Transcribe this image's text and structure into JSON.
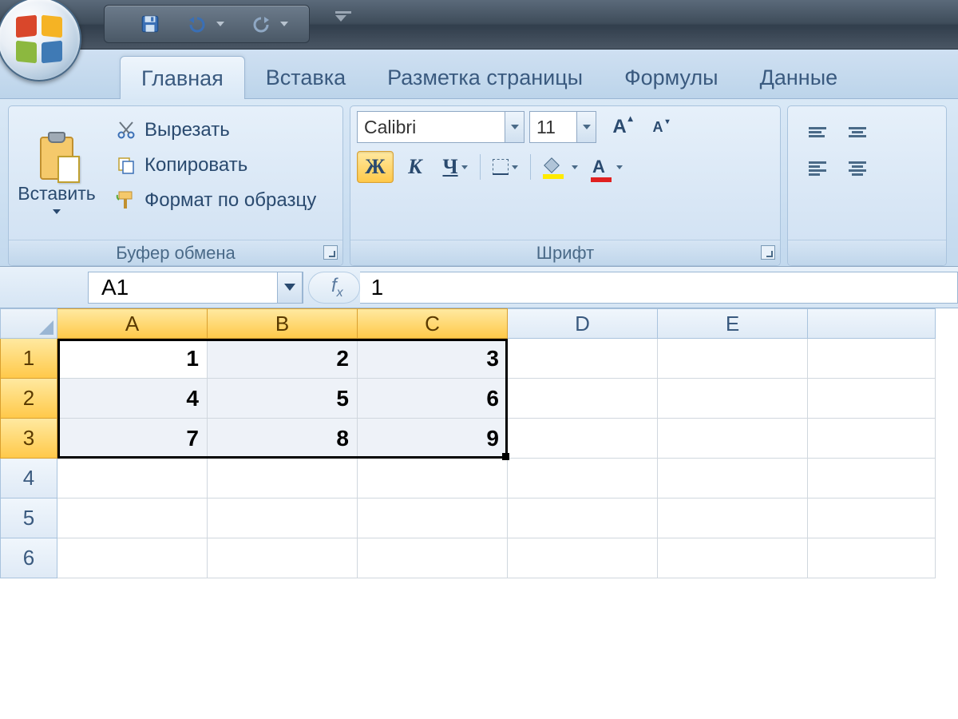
{
  "qat": {
    "save": "save",
    "undo": "undo",
    "redo": "redo",
    "customize": "customize"
  },
  "tabs": [
    "Главная",
    "Вставка",
    "Разметка страницы",
    "Формулы",
    "Данные"
  ],
  "active_tab": 0,
  "clipboard": {
    "paste": "Вставить",
    "cut": "Вырезать",
    "copy": "Копировать",
    "format_painter": "Формат по образцу",
    "group_label": "Буфер обмена"
  },
  "font": {
    "name": "Calibri",
    "size": "11",
    "bold": "Ж",
    "italic": "К",
    "underline": "Ч",
    "group_label": "Шрифт",
    "grow": "A",
    "shrink": "A",
    "font_color_letter": "A"
  },
  "formula_bar": {
    "name_box": "A1",
    "fx": "fx",
    "value": "1"
  },
  "grid": {
    "columns": [
      "A",
      "B",
      "C",
      "D",
      "E"
    ],
    "rows": [
      "1",
      "2",
      "3",
      "4",
      "5",
      "6"
    ],
    "selected_cols": [
      0,
      1,
      2
    ],
    "selected_rows": [
      0,
      1,
      2
    ],
    "data": [
      [
        "1",
        "2",
        "3",
        "",
        ""
      ],
      [
        "4",
        "5",
        "6",
        "",
        ""
      ],
      [
        "7",
        "8",
        "9",
        "",
        ""
      ],
      [
        "",
        "",
        "",
        "",
        ""
      ],
      [
        "",
        "",
        "",
        "",
        ""
      ],
      [
        "",
        "",
        "",
        "",
        ""
      ]
    ]
  }
}
